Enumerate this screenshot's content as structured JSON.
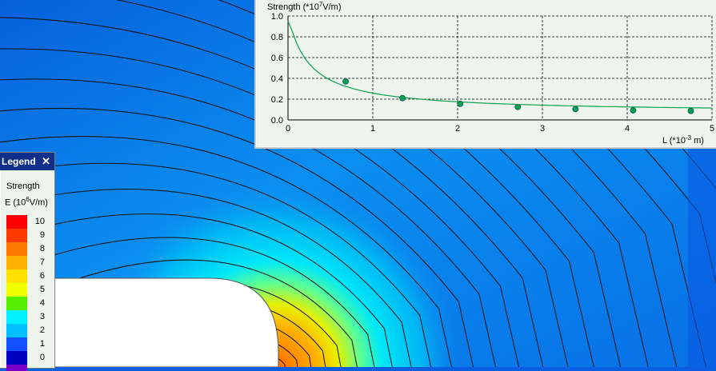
{
  "chart_data": {
    "type": "line",
    "ylabel_text": "Strength (*10",
    "ylabel_exp": "7",
    "ylabel_unit": "V/m)",
    "xlabel_text": "L (*10",
    "xlabel_exp": "-3",
    "xlabel_unit": " m)",
    "xlim": [
      0,
      5
    ],
    "ylim": [
      0,
      1.0
    ],
    "xticks": [
      "0",
      "1",
      "2",
      "3",
      "4",
      "5"
    ],
    "yticks": [
      "0.0",
      "0.2",
      "0.4",
      "0.6",
      "0.8",
      "1.0"
    ],
    "grid": true,
    "series": [
      {
        "markers_x": [
          0.68,
          1.35,
          2.03,
          2.71,
          3.39,
          4.07,
          4.75
        ],
        "markers_y": [
          0.37,
          0.21,
          0.155,
          0.125,
          0.105,
          0.092,
          0.087
        ],
        "color": "#0aa050"
      }
    ]
  },
  "legend": {
    "title": "Legend",
    "close": "✕",
    "quantity": "Strength",
    "unit_prefix": "E (10",
    "unit_exp": "6",
    "unit_suffix": "V/m)",
    "levels": [
      "10",
      "9",
      "8",
      "7",
      "6",
      "5",
      "4",
      "3",
      "2",
      "1",
      "0"
    ],
    "colors": [
      "#ff0000",
      "#ff3a00",
      "#ff7a00",
      "#ffb000",
      "#ffe000",
      "#f0ff00",
      "#55ee00",
      "#00f0ff",
      "#00c0ff",
      "#1050ff",
      "#0000c0"
    ],
    "bottom_color": "#7a00c8"
  },
  "field_colors": {
    "background": "#0a5fe0",
    "conductor": "#ffffff"
  }
}
